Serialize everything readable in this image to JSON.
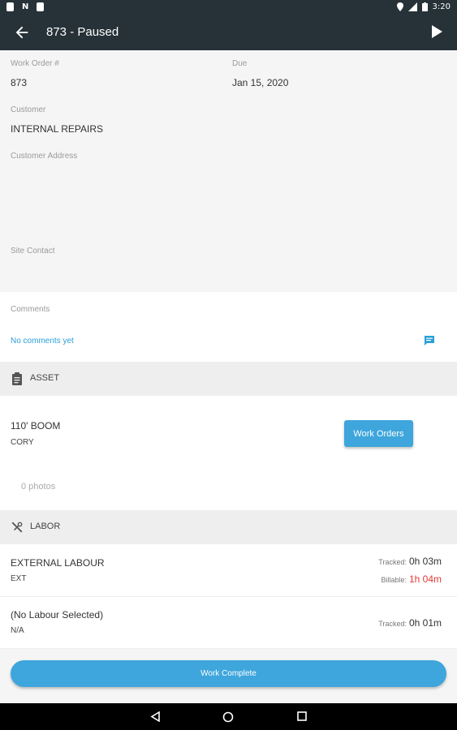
{
  "status_bar": {
    "time": "3:20"
  },
  "app_bar": {
    "title": "873 - Paused"
  },
  "work_order": {
    "number_label": "Work Order #",
    "number_value": "873",
    "due_label": "Due",
    "due_value": "Jan 15, 2020",
    "customer_label": "Customer",
    "customer_value": "INTERNAL REPAIRS",
    "address_label": "Customer Address",
    "site_contact_label": "Site Contact"
  },
  "comments": {
    "label": "Comments",
    "empty_text": "No comments yet"
  },
  "asset": {
    "section_title": "ASSET",
    "name": "110' BOOM",
    "owner": "CORY",
    "work_orders_button": "Work Orders",
    "photos_text": "0 photos"
  },
  "labor": {
    "section_title": "LABOR",
    "rows": [
      {
        "name": "EXTERNAL LABOUR",
        "code": "EXT",
        "tracked_label": "Tracked:",
        "tracked_value": "0h 03m",
        "billable_label": "Billable:",
        "billable_value": "1h 04m"
      },
      {
        "name": "(No Labour Selected)",
        "code": "N/A",
        "tracked_label": "Tracked:",
        "tracked_value": "0h 01m"
      }
    ]
  },
  "actions": {
    "complete_button": "Work Complete"
  },
  "icons": {
    "back": "arrow-left-icon",
    "play": "play-icon",
    "comment": "comment-icon",
    "asset": "clipboard-icon",
    "labor": "tools-icon",
    "nav_back": "nav-back-icon",
    "nav_home": "nav-home-icon",
    "nav_recents": "nav-recents-icon"
  },
  "colors": {
    "header": "#263238",
    "accent": "#3ea6dc",
    "billable": "#e53935"
  }
}
